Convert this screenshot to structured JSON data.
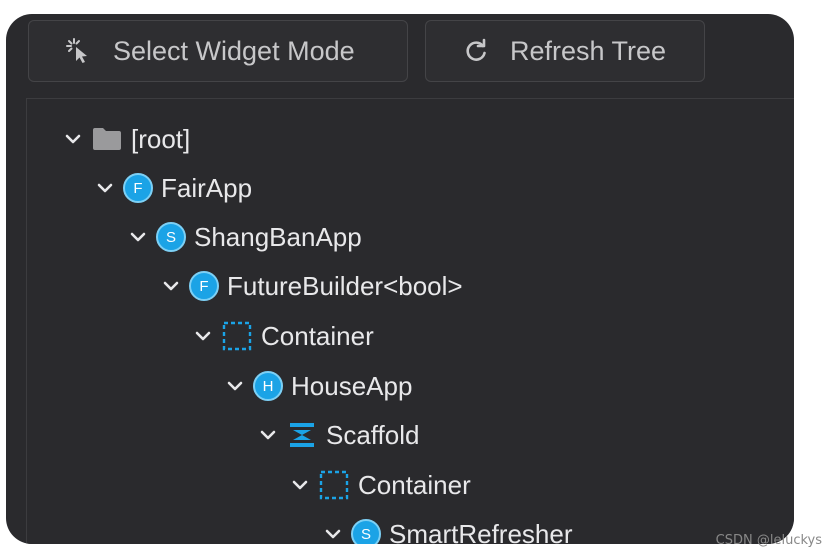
{
  "toolbar": {
    "select_label": "Select Widget Mode",
    "refresh_label": "Refresh Tree"
  },
  "tree": {
    "root": {
      "label": "[root]",
      "icon": "folder-icon"
    },
    "nodes": [
      {
        "label": "FairApp",
        "icon": "widget-badge-icon",
        "badge": "F"
      },
      {
        "label": "ShangBanApp",
        "icon": "widget-badge-icon",
        "badge": "S"
      },
      {
        "label": "FutureBuilder<bool>",
        "icon": "widget-badge-icon",
        "badge": "F"
      },
      {
        "label": "Container",
        "icon": "container-icon"
      },
      {
        "label": "HouseApp",
        "icon": "widget-badge-icon",
        "badge": "H"
      },
      {
        "label": "Scaffold",
        "icon": "scaffold-icon"
      },
      {
        "label": "Container",
        "icon": "container-icon"
      },
      {
        "label": "SmartRefresher",
        "icon": "widget-badge-icon",
        "badge": "S"
      }
    ]
  },
  "watermark": "CSDN @leluckys",
  "colors": {
    "panel_bg": "#2a2a2d",
    "badge_blue": "#1ba3e6",
    "text": "#e8e8ea"
  }
}
